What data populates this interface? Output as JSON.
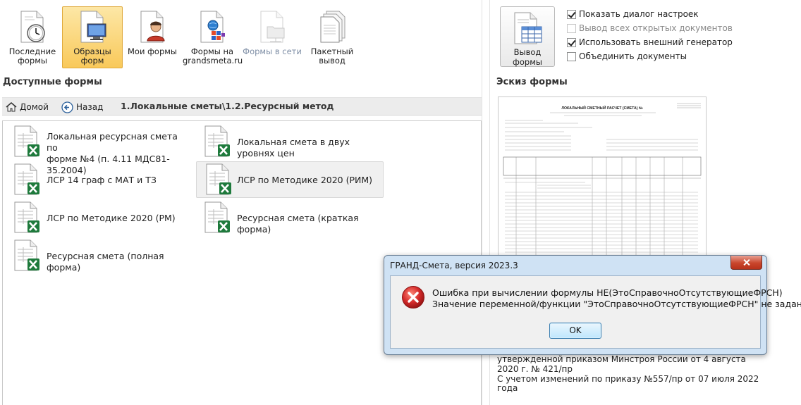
{
  "toolbar": {
    "items": [
      {
        "label": "Последние формы",
        "icon": "clock-document-icon"
      },
      {
        "label": "Образцы форм",
        "icon": "monitor-document-icon"
      },
      {
        "label": "Мои формы",
        "icon": "user-document-icon"
      },
      {
        "label": "Формы на grandsmeta.ru",
        "icon": "web-document-icon"
      },
      {
        "label": "Формы в сети",
        "icon": "network-folder-icon"
      },
      {
        "label": "Пакетный вывод",
        "icon": "batch-documents-icon"
      }
    ]
  },
  "available_forms": {
    "title": "Доступные формы",
    "nav": {
      "home": "Домой",
      "back": "Назад",
      "breadcrumb": "1.Локальные сметы\\1.2.Ресурсный метод"
    },
    "items": [
      {
        "label_lines": [
          "Локальная ресурсная смета по",
          "форме №4 (п. 4.11 МДС81-35.2004)"
        ]
      },
      {
        "label_lines": [
          "Локальная смета в двух уровнях цен"
        ]
      },
      {
        "label_lines": [
          "ЛСР 14 граф с МАТ и ТЗ"
        ]
      },
      {
        "label_lines": [
          "ЛСР по Методике 2020 (РИМ)"
        ]
      },
      {
        "label_lines": [
          "ЛСР по Методике 2020 (РМ)"
        ]
      },
      {
        "label_lines": [
          "Ресурсная смета (краткая форма)"
        ]
      },
      {
        "label_lines": [
          "Ресурсная смета (полная форма)"
        ]
      }
    ]
  },
  "output": {
    "button_label": "Вывод формы",
    "options": [
      {
        "label": "Показать диалог настроек",
        "checked": true,
        "enabled": true
      },
      {
        "label": "Вывод всех открытых документов",
        "checked": false,
        "enabled": false
      },
      {
        "label": "Использовать внешний генератор",
        "checked": true,
        "enabled": true
      },
      {
        "label": "Объединить документы",
        "checked": false,
        "enabled": true
      }
    ]
  },
  "sketch": {
    "title": "Эскиз формы",
    "preview_heading": "ЛОКАЛЬНЫЙ СМЕТНЫЙ РАСЧЕТ (СМЕТА) №"
  },
  "description": {
    "lines": [
      "утвержденной приказом Минстроя России от 4 августа",
      "2020 г. № 421/пр",
      "С учетом изменений по приказу №557/пр от 07 июля 2022",
      "года"
    ]
  },
  "dialog": {
    "title": "ГРАНД-Смета, версия 2023.3",
    "message_line1": "Ошибка при вычислении формулы НЕ(ЭтоСправочноОтсутствующиеФРСН)",
    "message_line2": "Значение переменной/функции \"ЭтоСправочноОтсутствующиеФРСН\" не задано",
    "ok_label": "OK"
  },
  "colors": {
    "toolbar_active": "#f9c95a",
    "excel_green": "#1e7a3c",
    "dialog_frame": "#cfe2f4",
    "error_red": "#d42a2a"
  }
}
